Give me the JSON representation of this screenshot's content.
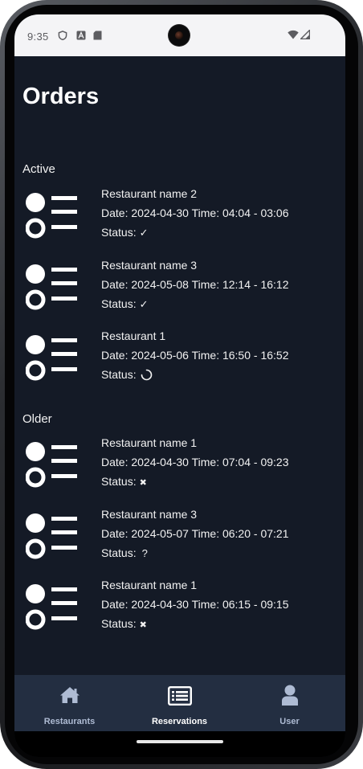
{
  "status_bar": {
    "time": "9:35",
    "left_icons": [
      "shield-icon",
      "a-badge-icon",
      "sd-card-icon"
    ],
    "right_icons": [
      "wifi-icon",
      "cellular-signal-icon"
    ]
  },
  "page": {
    "title": "Orders"
  },
  "sections": [
    {
      "label": "Active",
      "orders": [
        {
          "name": "Restaurant name 2",
          "details": "Date: 2024-04-30 Time: 04:04 - 03:06",
          "status_label": "Status:",
          "status_symbol": "✓",
          "status_icon": "checkmark-icon"
        },
        {
          "name": "Restaurant name 3",
          "details": "Date: 2024-05-08 Time: 12:14 - 16:12",
          "status_label": "Status:",
          "status_symbol": "✓",
          "status_icon": "checkmark-icon"
        },
        {
          "name": "Restaurant 1",
          "details": "Date: 2024-05-06 Time: 16:50 - 16:52",
          "status_label": "Status:",
          "status_symbol": "",
          "status_icon": "loading-spinner-icon"
        }
      ]
    },
    {
      "label": "Older",
      "orders": [
        {
          "name": "Restaurant name 1",
          "details": "Date: 2024-04-30 Time: 07:04 - 09:23",
          "status_label": "Status:",
          "status_symbol": "✖",
          "status_icon": "cross-icon"
        },
        {
          "name": "Restaurant name 3",
          "details": "Date: 2024-05-07 Time: 06:20 - 07:21",
          "status_label": "Status:",
          "status_symbol": "?",
          "status_icon": "question-icon"
        },
        {
          "name": "Restaurant name 1",
          "details": "Date: 2024-04-30 Time: 06:15 - 09:15",
          "status_label": "Status:",
          "status_symbol": "✖",
          "status_icon": "cross-icon"
        }
      ]
    }
  ],
  "bottom_nav": {
    "items": [
      {
        "label": "Restaurants",
        "icon": "home-icon",
        "active": false
      },
      {
        "label": "Reservations",
        "icon": "list-icon",
        "active": true
      },
      {
        "label": "User",
        "icon": "person-icon",
        "active": false
      }
    ]
  },
  "colors": {
    "background": "#141a26",
    "nav_background": "#232e41",
    "nav_inactive": "#aebbd3",
    "text": "#f2f2f2"
  }
}
